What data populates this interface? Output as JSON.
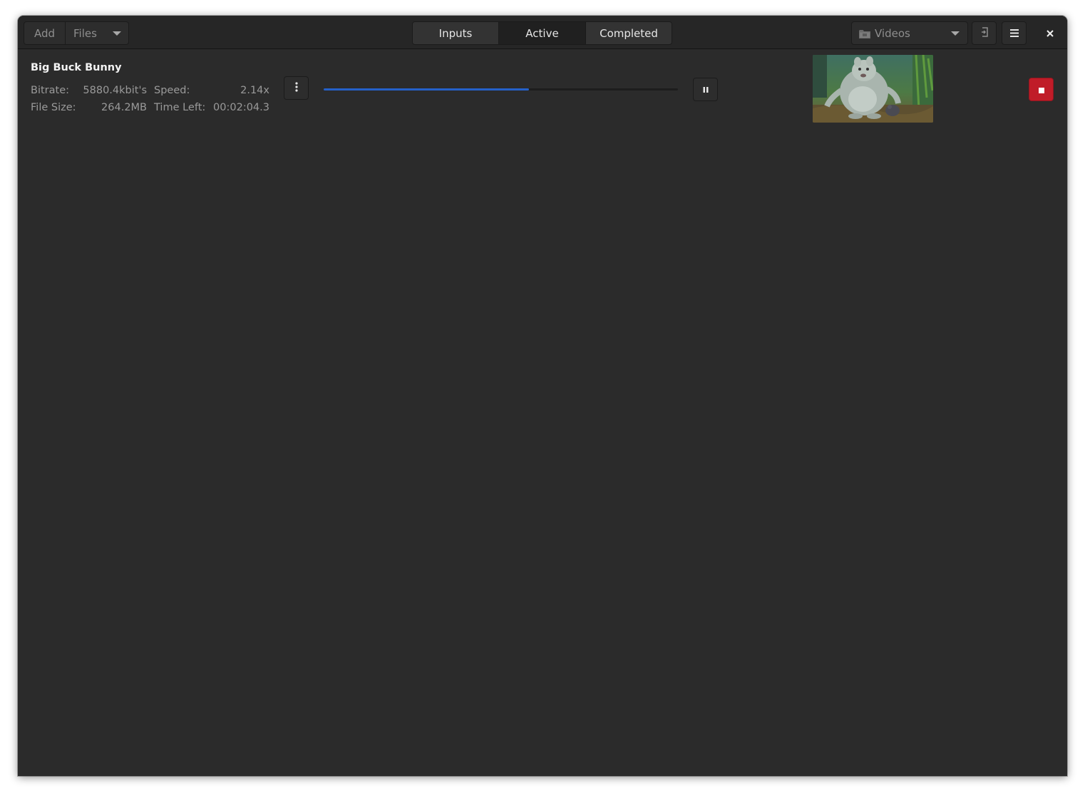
{
  "header": {
    "add_label": "Add",
    "files_label": "Files",
    "tabs": [
      {
        "label": "Inputs",
        "active": false
      },
      {
        "label": "Active",
        "active": true
      },
      {
        "label": "Completed",
        "active": false
      }
    ],
    "folder_label": "Videos"
  },
  "item": {
    "title": "Big Buck Bunny",
    "bitrate_label": "Bitrate:",
    "bitrate_value": "5880.4kbit's",
    "speed_label": "Speed:",
    "speed_value": "2.14x",
    "filesize_label": "File Size:",
    "filesize_value": "264.2MB",
    "timeleft_label": "Time Left:",
    "timeleft_value": "00:02:04.3",
    "progress": 0.58
  },
  "icons": {
    "folder": "folder-icon",
    "open_output": "exit-icon",
    "menu": "hamburger-menu-icon",
    "close": "close-icon",
    "more": "vertical-dots-icon",
    "pause": "pause-icon",
    "stop": "stop-icon"
  },
  "colors": {
    "progress": "#2561c9",
    "stop_button": "#c01c28",
    "window_bg": "#2b2b2b"
  }
}
